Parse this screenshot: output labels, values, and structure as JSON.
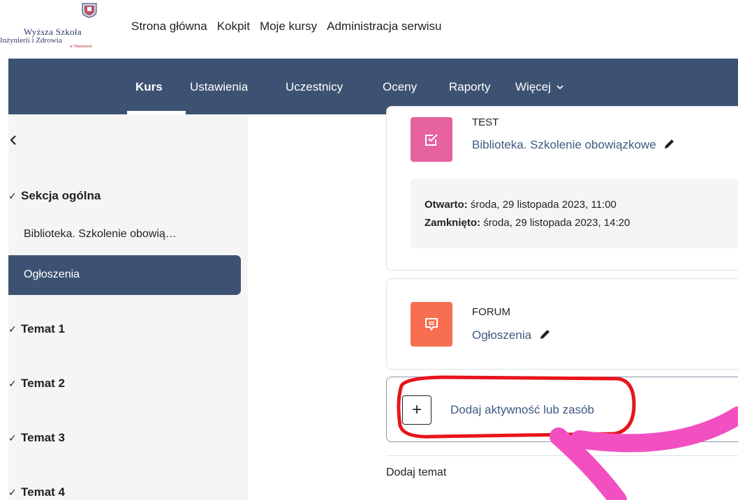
{
  "logo": {
    "line1": "Wyższa Szkoła",
    "line2": "Inżynierii i Zdrowia",
    "line3": "w Warszawie"
  },
  "topnav": {
    "items": [
      "Strona główna",
      "Kokpit",
      "Moje kursy",
      "Administracja serwisu"
    ]
  },
  "secnav": {
    "items": [
      "Kurs",
      "Ustawienia",
      "Uczestnicy",
      "Oceny",
      "Raporty",
      "Więcej"
    ],
    "active": "Kurs",
    "more_chevron": "chevron-down-icon"
  },
  "drawer": {
    "close_icon": "chevron-left-icon",
    "general_section": "Sekcja ogólna",
    "items": [
      "Biblioteka. Szkolenie obowią…",
      "Ogłoszenia"
    ],
    "active_item": "Ogłoszenia",
    "topics": [
      "Temat 1",
      "Temat 2",
      "Temat 3",
      "Temat 4"
    ]
  },
  "activities": {
    "quiz": {
      "type": "TEST",
      "name": "Biblioteka. Szkolenie obowiązkowe",
      "opened_label": "Otwarto:",
      "opened_value": "środa, 29 listopada 2023, 11:00",
      "closed_label": "Zamknięto:",
      "closed_value": "środa, 29 listopada 2023, 14:20"
    },
    "forum": {
      "type": "FORUM",
      "name": "Ogłoszenia"
    }
  },
  "add_activity": {
    "label": "Dodaj aktywność lub zasób",
    "plus": "+"
  },
  "add_topic": "Dodaj temat",
  "colors": {
    "navbar": "#3d5272",
    "quiz_icon": "#e6629f",
    "forum_icon": "#f76e50",
    "link": "#3d5a80",
    "highlight_red": "#e8141c",
    "arrow_pink": "#f24fc1"
  }
}
